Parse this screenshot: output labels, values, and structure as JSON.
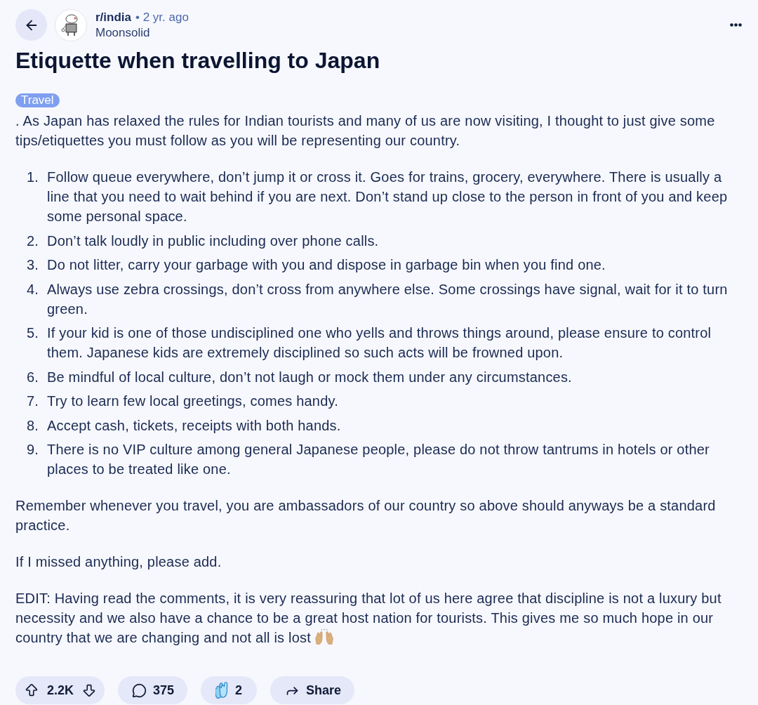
{
  "header": {
    "subreddit": "r/india",
    "age": "• 2 yr. ago",
    "author": "Moonsolid"
  },
  "post": {
    "title": "Etiquette when travelling to Japan",
    "flair": "Travel",
    "body": [
      {
        "kind": "paragraph",
        "text": ". As Japan has relaxed the rules for Indian tourists and many of us are now visiting, I thought to just give some tips/etiquettes you must follow as you will be representing our country."
      },
      {
        "kind": "list",
        "items": [
          {
            "number": "1.",
            "text": "Follow queue everywhere, don’t jump it or cross it. Goes for trains, grocery, everywhere. There is usually a line that you need to wait behind if you are next. Don’t stand up close to the person in front of you and keep some personal space."
          },
          {
            "number": "2.",
            "text": "Don’t talk loudly in public including over phone calls."
          },
          {
            "number": "3.",
            "text": "Do not litter, carry your garbage with you and dispose in garbage bin when you find one."
          },
          {
            "number": "4.",
            "text": "Always use zebra crossings, don’t cross from anywhere else. Some crossings have signal, wait for it to turn green."
          },
          {
            "number": "5.",
            "text": "If your kid is one of those undisciplined one who yells and throws things around, please ensure to control them. Japanese kids are extremely disciplined so such acts will be frowned upon."
          },
          {
            "number": "6.",
            "text": "Be mindful of local culture, don’t not laugh or mock them under any circumstances."
          },
          {
            "number": "7.",
            "text": "Try to learn few local greetings, comes handy."
          },
          {
            "number": "8.",
            "text": "Accept cash, tickets, receipts with both hands."
          },
          {
            "number": "9.",
            "text": "There is no VIP culture among general Japanese people, please do not throw tantrums in hotels or other places to be treated like one."
          }
        ]
      },
      {
        "kind": "paragraph",
        "text": "Remember whenever you travel, you are ambassadors of our country so above should anyways be a standard practice."
      },
      {
        "kind": "paragraph",
        "text": "If I missed anything, please add."
      },
      {
        "kind": "paragraph",
        "text": "EDIT: Having read the comments, it is very reassuring that lot of us here agree that discipline is not a luxury but necessity and we also have a chance to be a great host nation for tourists. This gives me so much hope in our country that we are changing and not all is lost",
        "ends_with_icon": true
      }
    ]
  },
  "actions": [
    {
      "kind": "vote",
      "count": "2.2K"
    },
    {
      "kind": "comments",
      "count": "375"
    },
    {
      "kind": "award",
      "count": "2"
    },
    {
      "kind": "share",
      "label": "Share"
    }
  ]
}
